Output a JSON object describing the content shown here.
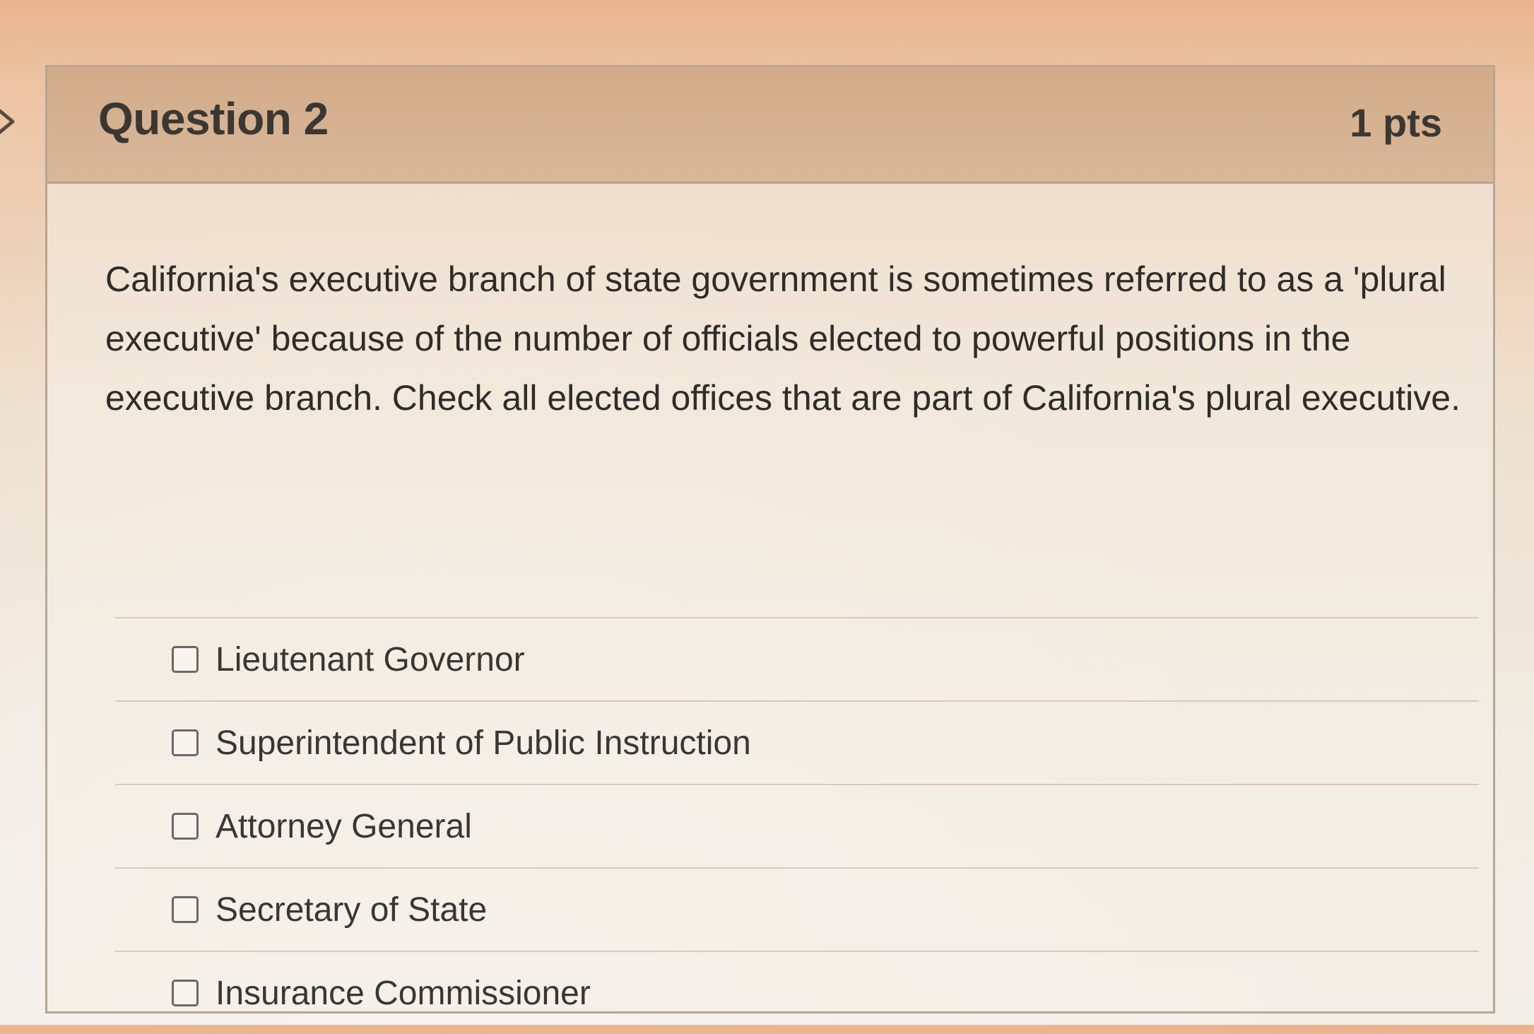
{
  "question": {
    "title": "Question 2",
    "points": "1 pts",
    "text": "California's executive branch of state government is sometimes referred to as a 'plural executive' because of the number of officials elected to powerful positions in the executive branch. Check all elected offices that are part of California's plural executive."
  },
  "answers": [
    {
      "label": "Lieutenant Governor",
      "checked": false
    },
    {
      "label": "Superintendent of Public Instruction",
      "checked": false
    },
    {
      "label": "Attorney General",
      "checked": false
    },
    {
      "label": "Secretary of State",
      "checked": false
    },
    {
      "label": "Insurance Commissioner",
      "checked": false
    }
  ],
  "icons": {
    "collapse": "chevron-right-icon"
  }
}
